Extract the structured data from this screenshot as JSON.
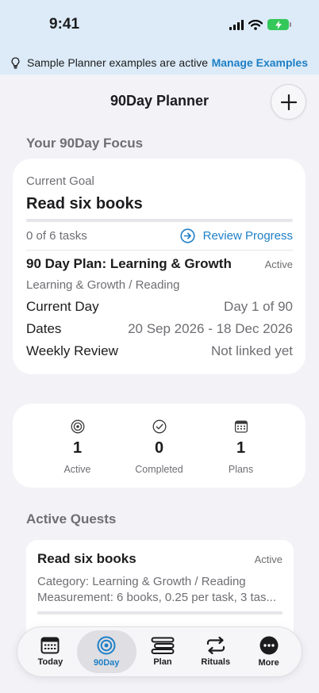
{
  "status": {
    "time": "9:41"
  },
  "banner": {
    "text": "Sample Planner examples are active",
    "action": "Manage Examples"
  },
  "nav": {
    "title": "90Day Planner"
  },
  "focus": {
    "section_title": "Your 90Day Focus",
    "current_goal_label": "Current Goal",
    "goal_title": "Read six books",
    "progress": 0,
    "tasks_text": "0 of 6 tasks",
    "review_label": "Review Progress",
    "plan_title": "90 Day Plan: Learning & Growth",
    "plan_status": "Active",
    "plan_category": "Learning & Growth / Reading",
    "rows": [
      {
        "label": "Current Day",
        "value": "Day 1 of 90"
      },
      {
        "label": "Dates",
        "value": "20 Sep 2026 - 18 Dec 2026"
      },
      {
        "label": "Weekly Review",
        "value": "Not linked yet"
      }
    ]
  },
  "stats": [
    {
      "icon": "target-icon",
      "value": "1",
      "label": "Active"
    },
    {
      "icon": "checkmark-circle-icon",
      "value": "0",
      "label": "Completed"
    },
    {
      "icon": "calendar-icon",
      "value": "1",
      "label": "Plans"
    }
  ],
  "quests": {
    "section_title": "Active Quests",
    "items": [
      {
        "title": "Read six books",
        "status": "Active",
        "category": "Category: Learning & Growth / Reading",
        "measurement": "Measurement: 6 books, 0.25 per task, 3 tas...",
        "progress": 0
      }
    ]
  },
  "tabs": [
    {
      "label": "Today",
      "icon": "calendar-grid-icon"
    },
    {
      "label": "90Day",
      "icon": "target-icon",
      "active": true
    },
    {
      "label": "Plan",
      "icon": "list-icon"
    },
    {
      "label": "Rituals",
      "icon": "repeat-icon"
    },
    {
      "label": "More",
      "icon": "ellipsis-icon"
    }
  ],
  "colors": {
    "accent": "#1e7fc6",
    "background": "#f2f2f7",
    "banner": "#dcebf7",
    "battery": "#34c759"
  }
}
